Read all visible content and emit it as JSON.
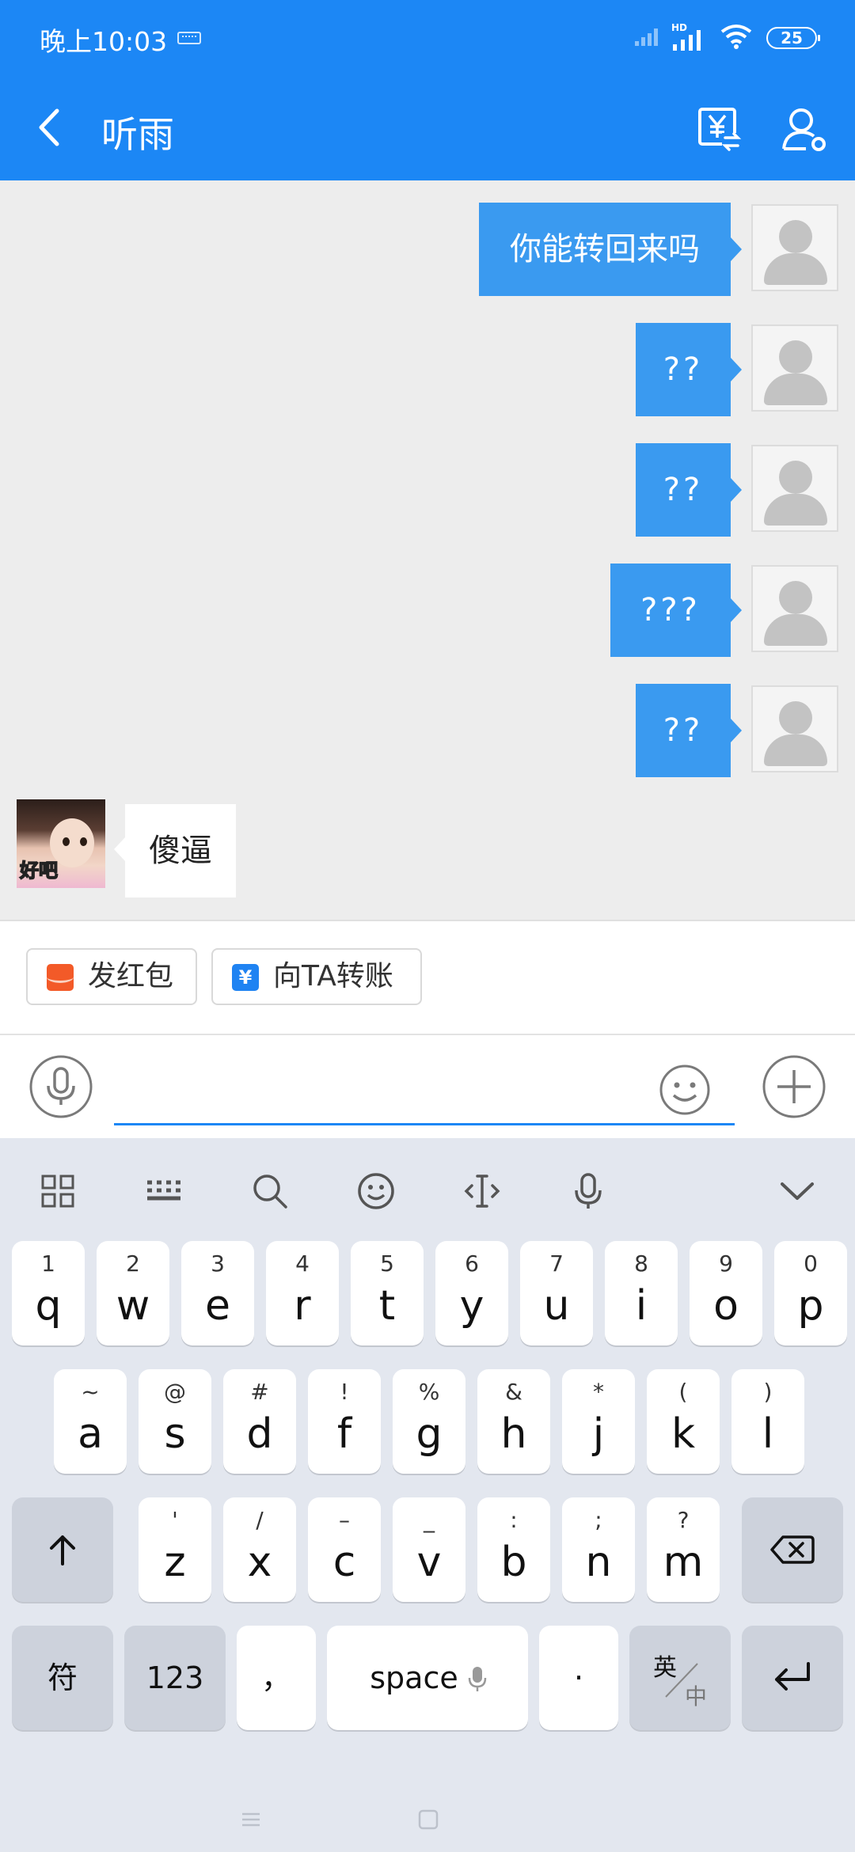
{
  "status_bar": {
    "time": "晚上10:03",
    "network_label": "HD",
    "battery": "25"
  },
  "header": {
    "title": "听雨",
    "back_icon": "chevron-left-icon",
    "transfer_icon": "yuan-transfer-icon",
    "profile_icon": "person-settings-icon",
    "color": "#1c87f5"
  },
  "messages": [
    {
      "direction": "outgoing",
      "text": "你能转回来吗"
    },
    {
      "direction": "outgoing",
      "text": "??"
    },
    {
      "direction": "outgoing",
      "text": "??"
    },
    {
      "direction": "outgoing",
      "text": "???"
    },
    {
      "direction": "outgoing",
      "text": "??"
    },
    {
      "direction": "incoming",
      "text": "傻逼",
      "avatar_sticker_text": "好吧"
    }
  ],
  "quick_actions": [
    {
      "label": "发红包",
      "icon": "red-packet-icon"
    },
    {
      "label": "向TA转账",
      "icon": "yuan-icon"
    }
  ],
  "input": {
    "value": "",
    "placeholder": ""
  },
  "keyboard": {
    "toolbar": [
      "grid-icon",
      "keyboard-icon",
      "search-icon",
      "emoji-icon",
      "cursor-icon",
      "microphone-icon",
      "collapse-icon"
    ],
    "row1": [
      {
        "hint": "1",
        "key": "q"
      },
      {
        "hint": "2",
        "key": "w"
      },
      {
        "hint": "3",
        "key": "e"
      },
      {
        "hint": "4",
        "key": "r"
      },
      {
        "hint": "5",
        "key": "t"
      },
      {
        "hint": "6",
        "key": "y"
      },
      {
        "hint": "7",
        "key": "u"
      },
      {
        "hint": "8",
        "key": "i"
      },
      {
        "hint": "9",
        "key": "o"
      },
      {
        "hint": "0",
        "key": "p"
      }
    ],
    "row2": [
      {
        "hint": "~",
        "key": "a"
      },
      {
        "hint": "@",
        "key": "s"
      },
      {
        "hint": "#",
        "key": "d"
      },
      {
        "hint": "!",
        "key": "f"
      },
      {
        "hint": "%",
        "key": "g"
      },
      {
        "hint": "&",
        "key": "h"
      },
      {
        "hint": "*",
        "key": "j"
      },
      {
        "hint": "(",
        "key": "k"
      },
      {
        "hint": ")",
        "key": "l"
      }
    ],
    "row3": [
      {
        "hint": "'",
        "key": "z"
      },
      {
        "hint": "/",
        "key": "x"
      },
      {
        "hint": "–",
        "key": "c"
      },
      {
        "hint": "_",
        "key": "v"
      },
      {
        "hint": ":",
        "key": "b"
      },
      {
        "hint": ";",
        "key": "n"
      },
      {
        "hint": "?",
        "key": "m"
      }
    ],
    "symbols_label": "符",
    "numbers_label": "123",
    "comma_label": "，",
    "space_label": "space",
    "period_label": "·",
    "lang_en": "英",
    "lang_zh": "中"
  }
}
